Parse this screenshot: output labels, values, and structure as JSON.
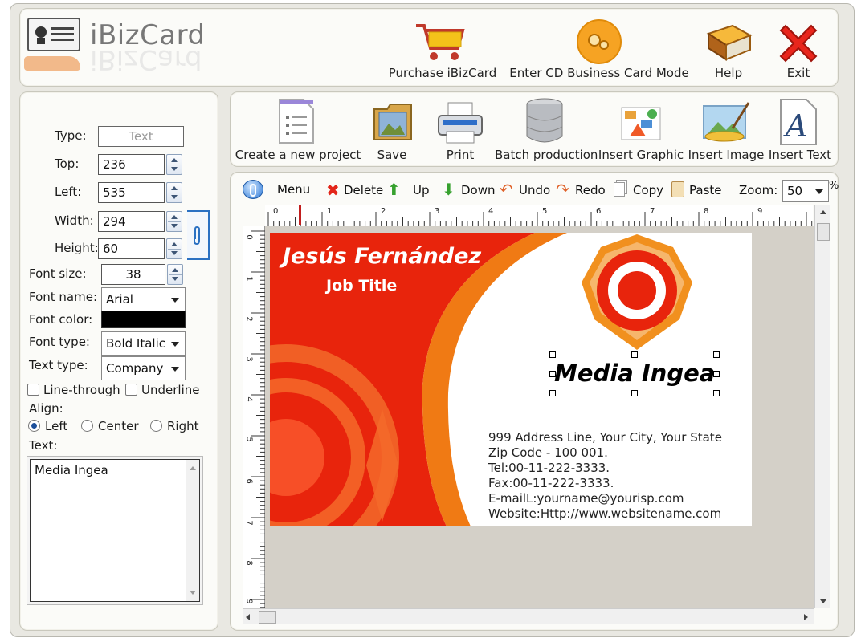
{
  "app": {
    "title": "iBizCard"
  },
  "header": {
    "purchase_label": "Purchase iBizCard",
    "cd_mode_label": "Enter CD Business Card Mode",
    "help_label": "Help",
    "exit_label": "Exit"
  },
  "toolbar": {
    "new_project": "Create a new project",
    "save": "Save",
    "print": "Print",
    "batch": "Batch production",
    "insert_graphic": "Insert Graphic",
    "insert_image": "Insert Image",
    "insert_text": "Insert Text"
  },
  "edit_bar": {
    "menu": "Menu",
    "delete": "Delete",
    "up": "Up",
    "down": "Down",
    "undo": "Undo",
    "redo": "Redo",
    "copy": "Copy",
    "paste": "Paste",
    "zoom_label": "Zoom:",
    "zoom_value": "50",
    "zoom_unit": "%"
  },
  "properties": {
    "type_label": "Type:",
    "type_value": "Text",
    "top_label": "Top:",
    "top_value": "236",
    "left_label": "Left:",
    "left_value": "535",
    "width_label": "Width:",
    "width_value": "294",
    "height_label": "Height:",
    "height_value": "60",
    "font_size_label": "Font size:",
    "font_size_value": "38",
    "font_name_label": "Font name:",
    "font_name_value": "Arial",
    "font_color_label": "Font color:",
    "font_color_value": "#000000",
    "font_type_label": "Font type:",
    "font_type_value": "Bold Italic",
    "text_type_label": "Text type:",
    "text_type_value": "Company",
    "linethrough_label": "Line-through",
    "underline_label": "Underline",
    "align_label": "Align:",
    "align_left": "Left",
    "align_center": "Center",
    "align_right": "Right",
    "align_selected": "Left",
    "text_label": "Text:",
    "text_value": "Media Ingea"
  },
  "ruler": {
    "horizontal": [
      "0",
      "1",
      "2",
      "3",
      "4",
      "5",
      "6",
      "7",
      "8",
      "9"
    ],
    "vertical": [
      "0",
      "1",
      "2",
      "3",
      "4",
      "5",
      "6",
      "7",
      "8",
      "9"
    ]
  },
  "card": {
    "name": "Jesús Fernández",
    "job_title": "Job Title",
    "company": "Media Ingea",
    "address": "999 Address Line, Your City, Your State",
    "zip": "Zip Code - 100 001.",
    "tel": "Tel:00-11-222-3333.",
    "fax": "Fax:00-11-222-3333.",
    "email": "E-mailL:yourname@yourisp.com",
    "website": "Website:Http://www.websitename.com",
    "colors": {
      "red": "#e8240c",
      "orange": "#f07a14"
    }
  }
}
